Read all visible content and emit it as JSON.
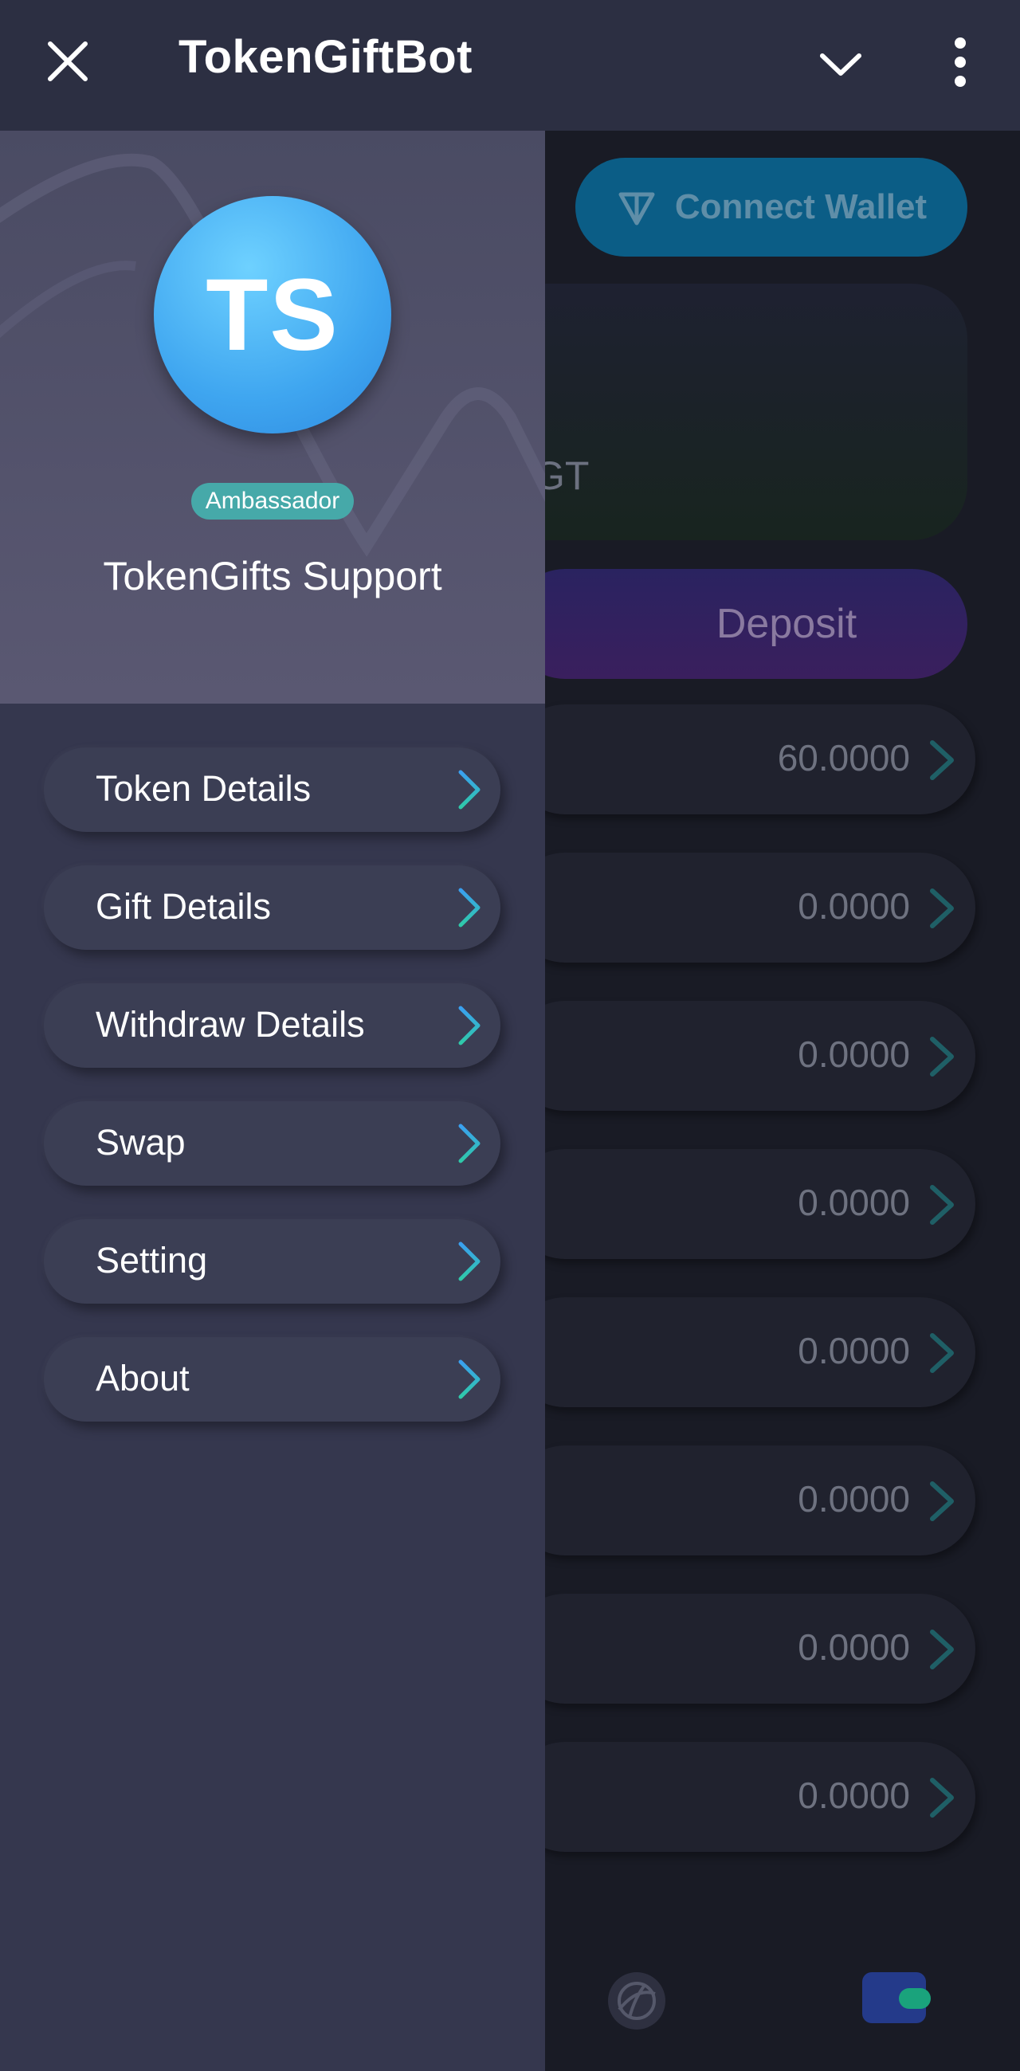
{
  "topbar": {
    "title": "TokenGiftBot",
    "close_icon": "close-icon",
    "collapse_icon": "chevron-down-icon",
    "more_icon": "more-vertical-icon"
  },
  "background_page": {
    "connect_wallet_label": "Connect Wallet",
    "balance_unit": "GT",
    "deposit_label": "Deposit",
    "token_values": [
      "60.0000",
      "0.0000",
      "0.0000",
      "0.0000",
      "0.0000",
      "0.0000",
      "0.0000",
      "0.0000"
    ],
    "bottom_nav_icons": [
      "explore-globe-icon",
      "wallet-icon"
    ]
  },
  "drawer": {
    "avatar_initials": "TS",
    "badge": "Ambassador",
    "user_name": "TokenGifts Support",
    "menu": [
      {
        "label": "Token Details"
      },
      {
        "label": "Gift Details"
      },
      {
        "label": "Withdraw Details"
      },
      {
        "label": "Swap"
      },
      {
        "label": "Setting"
      },
      {
        "label": "About"
      }
    ]
  },
  "colors": {
    "topbar": "#2c2f42",
    "drawer": "#35374e",
    "avatar": "#3fa6f0",
    "badge": "#46a9a9",
    "arrow_gradient_start": "#3aa0f0",
    "arrow_gradient_end": "#2fc9a9"
  }
}
